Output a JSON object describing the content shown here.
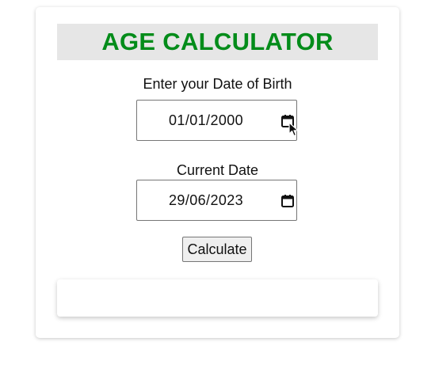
{
  "app": {
    "title": "AGE CALCULATOR"
  },
  "form": {
    "dob_label": "Enter your Date of Birth",
    "dob_value": "01/01/2000",
    "current_label": "Current Date",
    "current_value": "29/06/2023",
    "calculate_label": "Calculate"
  },
  "result": {
    "text": ""
  },
  "icons": {
    "calendar": "calendar-icon",
    "cursor": "mouse-cursor-icon"
  },
  "colors": {
    "title": "#038c1a",
    "title_background": "#e6e6e6",
    "button_background": "#efefef"
  }
}
